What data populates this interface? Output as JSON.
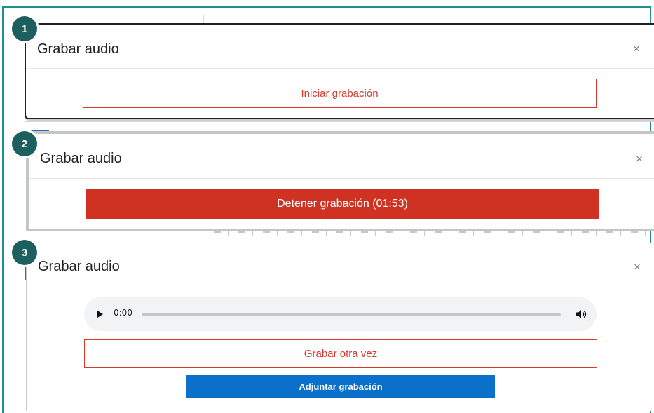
{
  "steps": [
    {
      "badge": "1",
      "dialog_title": "Grabar audio",
      "close_symbol": "×",
      "primary_button": "Iniciar grabación"
    },
    {
      "badge": "2",
      "dialog_title": "Grabar audio",
      "close_symbol": "×",
      "primary_button": "Detener grabación (01:53)"
    },
    {
      "badge": "3",
      "dialog_title": "Grabar audio",
      "close_symbol": "×",
      "audio_player": {
        "time": "0:00",
        "progress": 0
      },
      "secondary_button": "Grabar otra vez",
      "primary_button": "Adjuntar grabación"
    }
  ],
  "colors": {
    "frame": "#1e8f96",
    "badge": "#1d5f5f",
    "danger": "#cf3122",
    "primary": "#0b70c9"
  },
  "icons": [
    "close-icon",
    "play-icon",
    "volume-icon"
  ]
}
